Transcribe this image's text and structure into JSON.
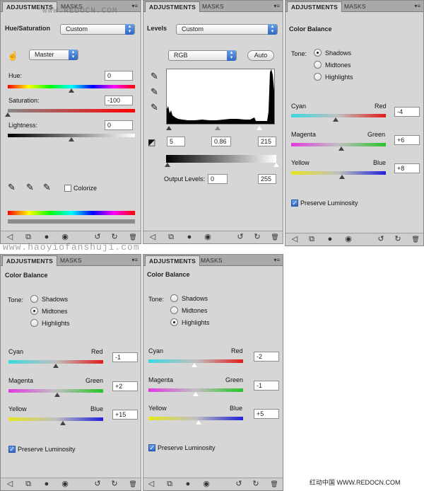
{
  "panel_hue": {
    "tab_active": "ADJUSTMENTS",
    "tab_inactive": "MASKS",
    "menu": "▾≡",
    "title": "Hue/Saturation",
    "preset": "Custom",
    "channel": "Master",
    "hue_label": "Hue:",
    "hue_value": "0",
    "saturation_label": "Saturation:",
    "saturation_value": "-100",
    "lightness_label": "Lightness:",
    "lightness_value": "0",
    "colorize_label": "Colorize"
  },
  "panel_levels": {
    "tab_active": "ADJUSTMENTS",
    "tab_inactive": "MASKS",
    "menu": "▾≡",
    "title": "Levels",
    "preset": "Custom",
    "channel": "RGB",
    "auto_label": "Auto",
    "input_black": "5",
    "input_gamma": "0.86",
    "input_white": "215",
    "output_label": "Output Levels:",
    "output_black": "0",
    "output_white": "255"
  },
  "panel_cb1": {
    "tab_active": "ADJUSTMENTS",
    "tab_inactive": "MASKS",
    "menu": "▾≡",
    "title": "Color Balance",
    "tone_label": "Tone:",
    "tones": [
      "Shadows",
      "Midtones",
      "Highlights"
    ],
    "selected_tone": 0,
    "cyan": "Cyan",
    "red": "Red",
    "magenta": "Magenta",
    "green": "Green",
    "yellow": "Yellow",
    "blue": "Blue",
    "v1": "-4",
    "v2": "+6",
    "v3": "+8",
    "preserve_label": "Preserve Luminosity"
  },
  "panel_cb2": {
    "tab_active": "ADJUSTMENTS",
    "tab_inactive": "MASKS",
    "menu": "▾≡",
    "title": "Color Balance",
    "tone_label": "Tone:",
    "tones": [
      "Shadows",
      "Midtones",
      "Highlights"
    ],
    "selected_tone": 1,
    "cyan": "Cyan",
    "red": "Red",
    "magenta": "Magenta",
    "green": "Green",
    "yellow": "Yellow",
    "blue": "Blue",
    "v1": "-1",
    "v2": "+2",
    "v3": "+15",
    "preserve_label": "Preserve Luminosity"
  },
  "panel_cb3": {
    "tab_active": "ADJUSTMENTS",
    "tab_inactive": "MASKS",
    "menu": "▾≡",
    "title": "Color Balance",
    "tone_label": "Tone:",
    "tones": [
      "Shadows",
      "Midtones",
      "Highlights"
    ],
    "selected_tone": 2,
    "cyan": "Cyan",
    "red": "Red",
    "magenta": "Magenta",
    "green": "Green",
    "yellow": "Yellow",
    "blue": "Blue",
    "v1": "-2",
    "v2": "-1",
    "v3": "+5",
    "preserve_label": "Preserve Luminosity"
  },
  "watermarks": {
    "top": "WWW.REDOCN.COM",
    "middle": "www.haoyiofanshuji.com",
    "footer": "红动中国 WWW.REDOCN.COM"
  },
  "icons": {
    "back": "◁",
    "clip": "⧉",
    "eye_dot": "●",
    "eye": "◉",
    "refresh_prev": "↺",
    "reset": "↻",
    "trash": "🗑"
  }
}
